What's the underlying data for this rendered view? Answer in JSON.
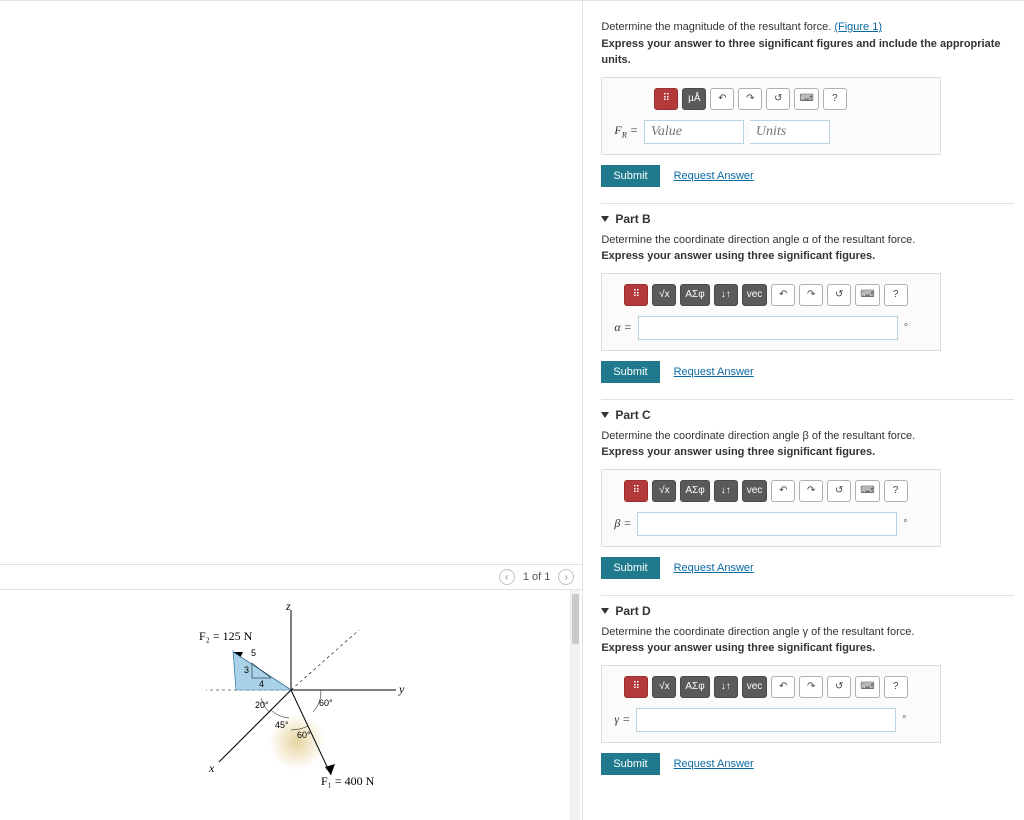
{
  "figure_nav": {
    "prev_glyph": "‹",
    "next_glyph": "›",
    "counter": "1 of 1"
  },
  "figure_labels": {
    "F2": "F₂ = 125 N",
    "F1": "F₁ = 400 N",
    "x": "x",
    "y": "y",
    "z": "z",
    "ang20": "20°",
    "ang45": "45°",
    "ang60a": "60°",
    "ang60b": "60°",
    "tri3": "3",
    "tri4": "4",
    "tri5": "5"
  },
  "partA": {
    "instruction": "Determine the magnitude of the resultant force.",
    "figure_link": "(Figure 1)",
    "guidance": "Express your answer to three significant figures and include the appropriate units.",
    "var_label_html": "F<sub>R</sub> =",
    "value_placeholder": "Value",
    "units_placeholder": "Units",
    "toolbar": {
      "templates": "⠿",
      "units": "µÅ",
      "undo": "↶",
      "redo": "↷",
      "reset": "↺",
      "keyboard": "⌨",
      "help": "?"
    }
  },
  "partB": {
    "title": "Part B",
    "instruction": "Determine the coordinate direction angle α of the resultant force.",
    "guidance": "Express your answer using three significant figures.",
    "var_label": "α =",
    "unit_suffix": "°"
  },
  "partC": {
    "title": "Part C",
    "instruction": "Determine the coordinate direction angle β of the resultant force.",
    "guidance": "Express your answer using three significant figures.",
    "var_label": "β =",
    "unit_suffix": "°"
  },
  "partD": {
    "title": "Part D",
    "instruction": "Determine the coordinate direction angle γ of the resultant force.",
    "guidance": "Express your answer using three significant figures.",
    "var_label": "γ =",
    "unit_suffix": "°"
  },
  "angle_toolbar": {
    "templates": "⠿",
    "sqrt": "√x",
    "greek": "ΑΣφ",
    "subsup": "↓↑",
    "vec": "vec",
    "undo": "↶",
    "redo": "↷",
    "reset": "↺",
    "keyboard": "⌨",
    "help": "?"
  },
  "common": {
    "submit": "Submit",
    "request": "Request Answer"
  }
}
